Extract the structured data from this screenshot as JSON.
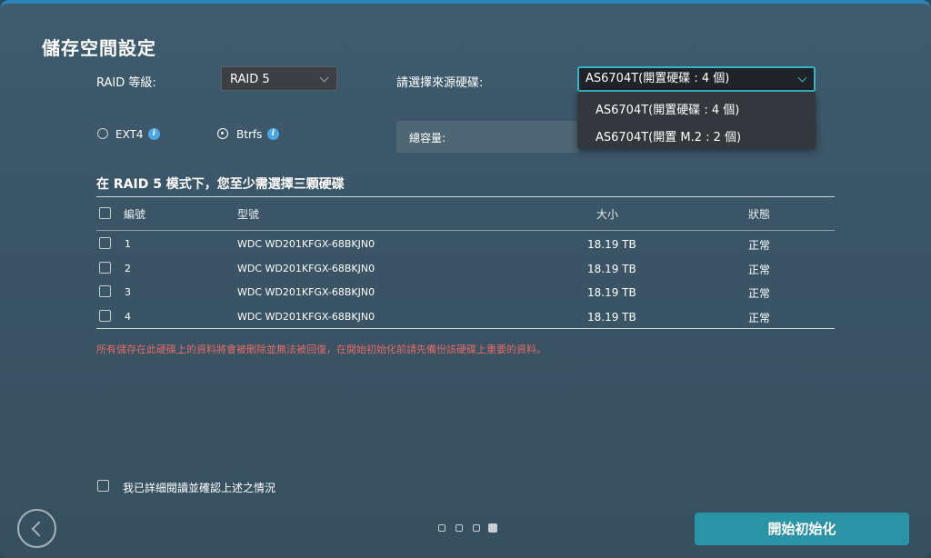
{
  "title": "儲存空間設定",
  "raid": {
    "label": "RAID 等級:",
    "selected": "RAID 5"
  },
  "source": {
    "label": "請選擇來源硬碟:",
    "selected": "AS6704T(開置硬碟 : 4 個)",
    "options": [
      "AS6704T(開置硬碟 : 4 個)",
      "AS6704T(開置 M.2 : 2 個)"
    ]
  },
  "filesystem": {
    "options": [
      {
        "label": "EXT4",
        "checked": false
      },
      {
        "label": "Btrfs",
        "checked": true
      }
    ],
    "info_glyph": "i"
  },
  "capacity_label": "總容量:",
  "section_title": "在 RAID 5 模式下，您至少需選擇三顆硬碟",
  "table": {
    "headers": {
      "number": "編號",
      "model": "型號",
      "size": "大小",
      "status": "狀態"
    },
    "rows": [
      {
        "number": "1",
        "model": "WDC WD201KFGX-68BKJN0",
        "size": "18.19 TB",
        "status": "正常"
      },
      {
        "number": "2",
        "model": "WDC WD201KFGX-68BKJN0",
        "size": "18.19 TB",
        "status": "正常"
      },
      {
        "number": "3",
        "model": "WDC WD201KFGX-68BKJN0",
        "size": "18.19 TB",
        "status": "正常"
      },
      {
        "number": "4",
        "model": "WDC WD201KFGX-68BKJN0",
        "size": "18.19 TB",
        "status": "正常"
      }
    ]
  },
  "warning": "所有儲存在此硬碟上的資料將會被刪除並無法被回復，在開始初始化前請先備份該硬碟上重要的資料。",
  "confirm_label": "我已詳細閱讀並確認上述之情況",
  "pagination": {
    "total": 4,
    "current": 4
  },
  "start_button": "開始初始化",
  "colors": {
    "accent": "#2a93a5",
    "focus": "#35b5c6",
    "warning": "#e36b67",
    "info": "#4aa6e6"
  }
}
